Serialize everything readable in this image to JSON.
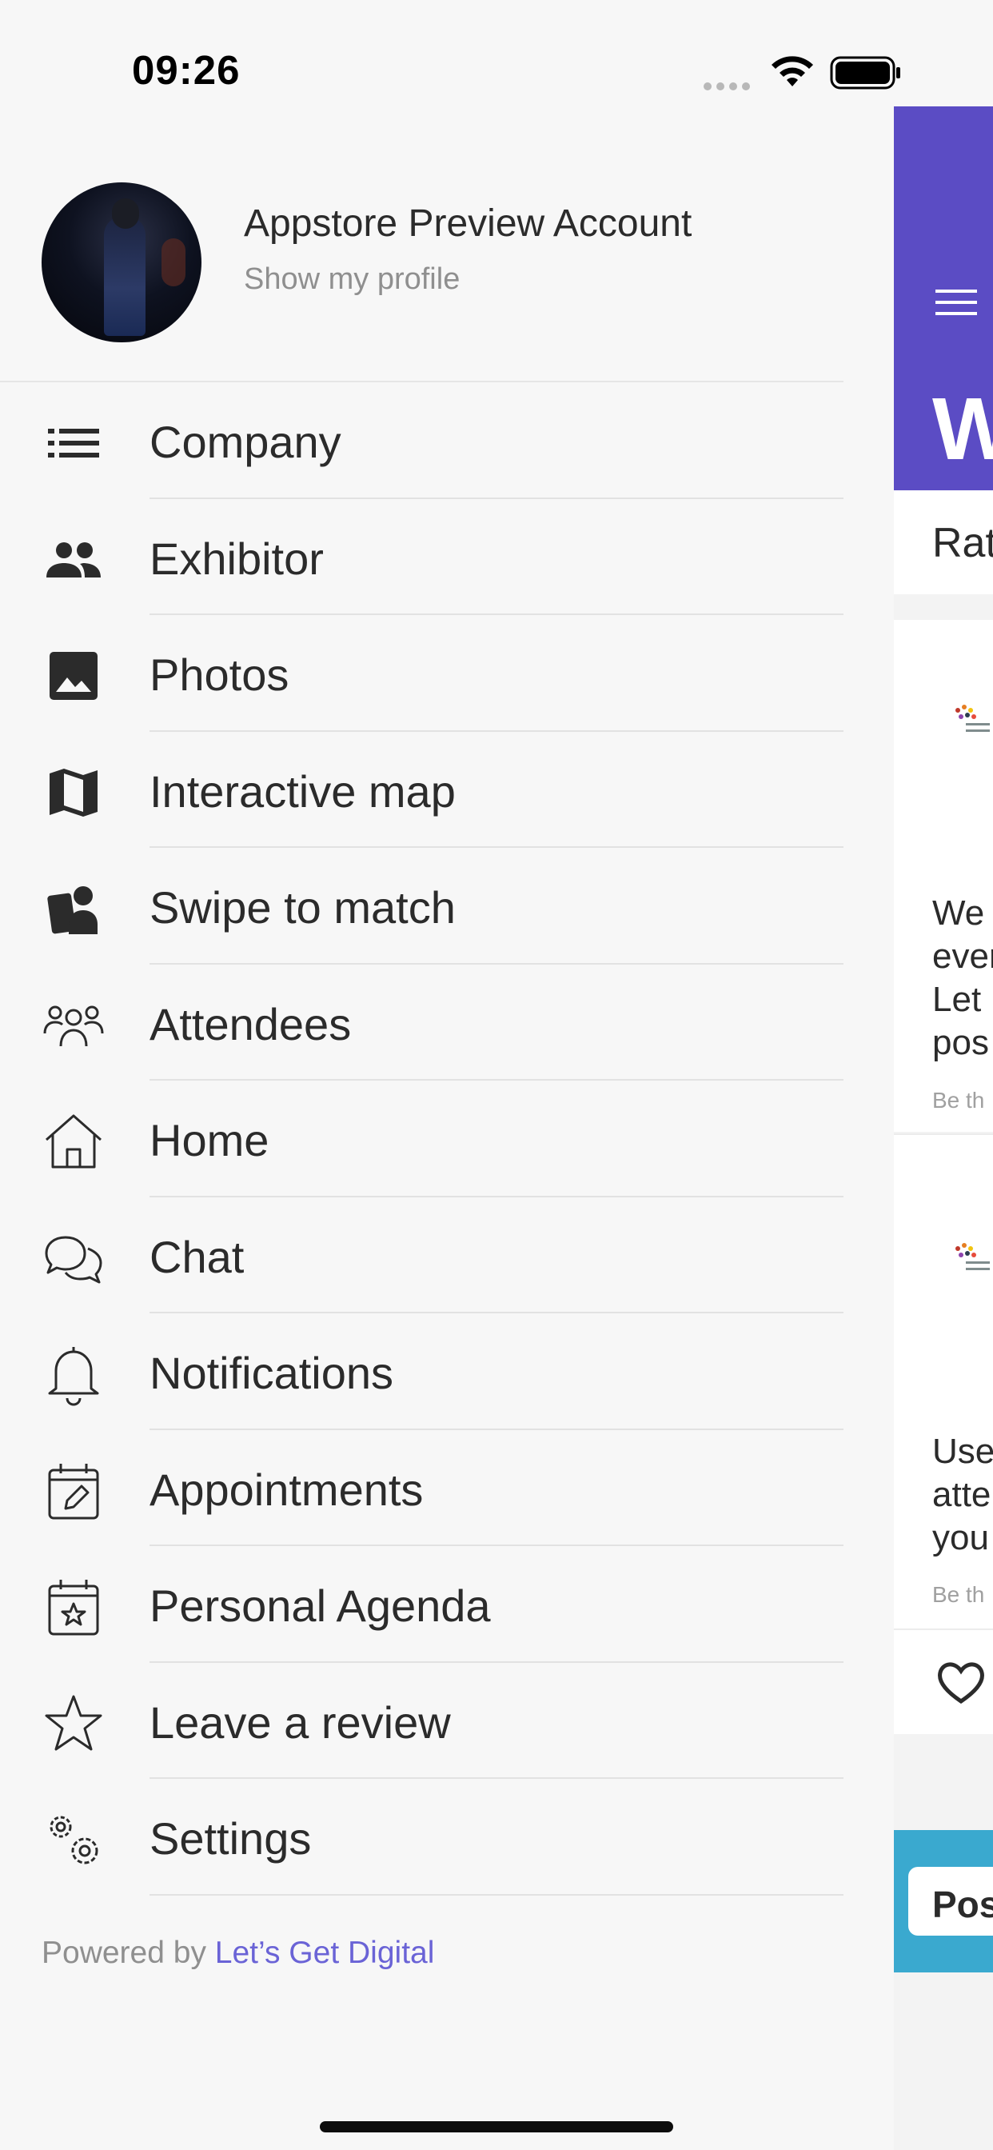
{
  "status_bar": {
    "time": "09:26"
  },
  "profile": {
    "name": "Appstore Preview Account",
    "link": "Show my profile"
  },
  "menu": {
    "items": [
      {
        "label": "Company",
        "icon": "list-icon"
      },
      {
        "label": "Exhibitor",
        "icon": "people-icon"
      },
      {
        "label": "Photos",
        "icon": "image-icon"
      },
      {
        "label": "Interactive map",
        "icon": "map-icon"
      },
      {
        "label": "Swipe to match",
        "icon": "swipe-match-icon"
      },
      {
        "label": "Attendees",
        "icon": "attendees-icon"
      },
      {
        "label": "Home",
        "icon": "home-icon"
      },
      {
        "label": "Chat",
        "icon": "chat-icon"
      },
      {
        "label": "Notifications",
        "icon": "bell-icon"
      },
      {
        "label": "Appointments",
        "icon": "calendar-edit-icon"
      },
      {
        "label": "Personal Agenda",
        "icon": "calendar-star-icon"
      },
      {
        "label": "Leave a review",
        "icon": "star-icon"
      },
      {
        "label": "Settings",
        "icon": "gears-icon"
      }
    ]
  },
  "footer": {
    "prefix": "Powered by ",
    "link": "Let’s Get Digital"
  },
  "background_page": {
    "title_fragment": "W",
    "rating_fragment": "Rat",
    "card1_text": "We\never\nLet\npos",
    "card1_be": "Be th",
    "card2_text": "Use\natte\nyou",
    "card2_be": "Be th",
    "post_button": "Pos"
  },
  "colors": {
    "accent": "#5b4cc4",
    "link": "#6a63d6",
    "post_bar": "#3aa9cf",
    "drawer_bg": "#f7f7f7"
  }
}
